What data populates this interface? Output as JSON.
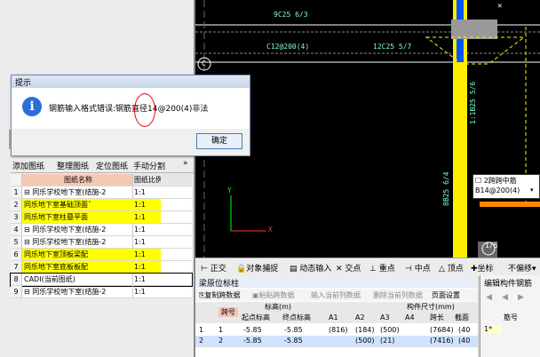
{
  "dialog": {
    "title": "提示",
    "message": "钢筋输入格式错误:钢筋直径14@200(4)非法",
    "ok_label": "确定"
  },
  "drawing_toolbar": {
    "add_label": "添加图纸",
    "organize_label": "整理图纸",
    "locate_label": "定位图纸",
    "split_label": "手动分割"
  },
  "drawing_table": {
    "col_name": "图纸名称",
    "col_scale": "图纸比例",
    "rows": [
      {
        "num": "1",
        "name": "同乐学校地下室(结施-2",
        "scale": "1:1"
      },
      {
        "num": "2",
        "name": "同乐地下室基础顶面ˇ",
        "scale": "1:1"
      },
      {
        "num": "3",
        "name": "同乐地下室柱墓平面",
        "scale": "1:1"
      },
      {
        "num": "4",
        "name": "同乐学校地下室(结施-2",
        "scale": "1:1"
      },
      {
        "num": "5",
        "name": "同乐学校地下室(结施-2",
        "scale": "1:1"
      },
      {
        "num": "6",
        "name": "同乐地下室顶板梁配",
        "scale": "1:1"
      },
      {
        "num": "7",
        "name": "同乐地下室底板板配",
        "scale": "1:1"
      },
      {
        "num": "8",
        "name": "CADI(当前图纸)",
        "scale": "1:1"
      },
      {
        "num": "9",
        "name": "同乐学校地下室(结施-2",
        "scale": "1:1"
      }
    ]
  },
  "canvas": {
    "texts": {
      "t1": "9C25 6/3",
      "t2": "C12@200(4)",
      "t3": "12C25 5/7",
      "t4": "C",
      "t5": "1:1B25 5/6",
      "t6": "8B25 6/4",
      "t7": "1/6",
      "t8": "2跨跨中筋",
      "t9": "B14@200(4)"
    }
  },
  "bottom_toolbar": {
    "orth": "正交",
    "snap": "对象捕捉",
    "dyn": "动态输入",
    "inter": "交点",
    "perp": "重点",
    "mid": "中点",
    "top": "顶点",
    "coord": "坐标",
    "offset": "不偏移"
  },
  "beam_panel": {
    "title": "梁原位标柱",
    "copy": "复制跨数据",
    "paste": "粘贴跨数据",
    "insert": "输入当前列数据",
    "delete": "删除当前列数据",
    "page": "页面设置",
    "h_span": "跨号",
    "h_elev": "标高(m)",
    "h_start": "起点标高",
    "h_end": "终点标高",
    "h_size": "构件尺寸(mm)",
    "h_a1": "A1",
    "h_a2": "A2",
    "h_a3": "A3",
    "h_a4": "A4",
    "h_len": "跨长",
    "h_sect": "截面",
    "rows": [
      {
        "n": "1",
        "span": "1",
        "start": "-5.85",
        "end": "-5.85",
        "a1": "(816)",
        "a2": "(184)",
        "a3": "(500)",
        "a4": "",
        "len": "(7684)",
        "sect": "(40"
      },
      {
        "n": "2",
        "span": "2",
        "start": "-5.85",
        "end": "-5.85",
        "a1": "",
        "a2": "(500)",
        "a3": "(21)",
        "a4": "",
        "len": "(7416)",
        "sect": "(40"
      }
    ]
  },
  "edit_panel": {
    "title": "编辑构件钢筋",
    "h_span": "筋号",
    "row_mark": "1*"
  },
  "colors": {
    "highlight": "#ffff00",
    "axis_blue": "#0055ff",
    "yellow_bar": "#ffee00",
    "orange": "#ff8800"
  }
}
